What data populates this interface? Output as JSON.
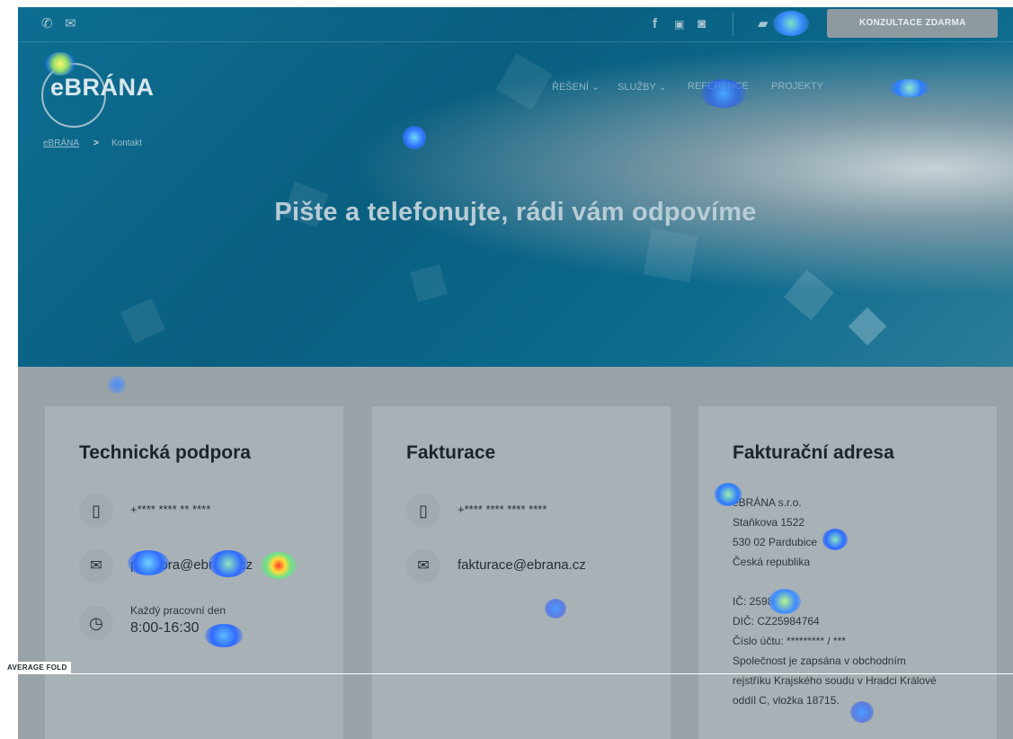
{
  "topbar": {
    "phone_icon": "phone-icon",
    "mail_icon": "envelope-icon",
    "social": [
      "facebook-icon",
      "youtube-icon",
      "instagram-icon"
    ],
    "briefcase_icon": "briefcase-icon",
    "cta_label": "KONZULTACE ZDARMA"
  },
  "header": {
    "logo_text": "eBRÁNA",
    "nav": [
      "ŘEŠENÍ",
      "SLUŽBY",
      "REFERENCE",
      "PROJEKTY"
    ]
  },
  "breadcrumb": {
    "home": "eBRÁNA",
    "separator": ">",
    "current": "Kontakt"
  },
  "hero": {
    "title": "Pište a telefonujte, rádi vám odpovíme"
  },
  "cards": {
    "support": {
      "title": "Technická podpora",
      "phone": "+**** **** ** ****",
      "email": "podpora@ebrana.cz",
      "hours_label": "Každý pracovní den",
      "hours": "8:00-16:30"
    },
    "billing": {
      "title": "Fakturace",
      "phone": "+**** **** **** ****",
      "email": "fakturace@ebrana.cz"
    },
    "address": {
      "title": "Fakturační adresa",
      "lines": [
        "eBRÁNA s.r.o.",
        "Staňkova 1522",
        "530 02 Pardubice",
        "Česká republika",
        "",
        "IČ: 25984764",
        "DIČ: CZ25984764",
        "Číslo účtu: ********* / ***",
        "Společnost je zapsána v obchodním",
        "rejstříku Krajského soudu v Hradci Králové",
        "oddíl C, vložka 18715."
      ]
    }
  },
  "overlay": {
    "fold_label": "AVERAGE FOLD"
  }
}
